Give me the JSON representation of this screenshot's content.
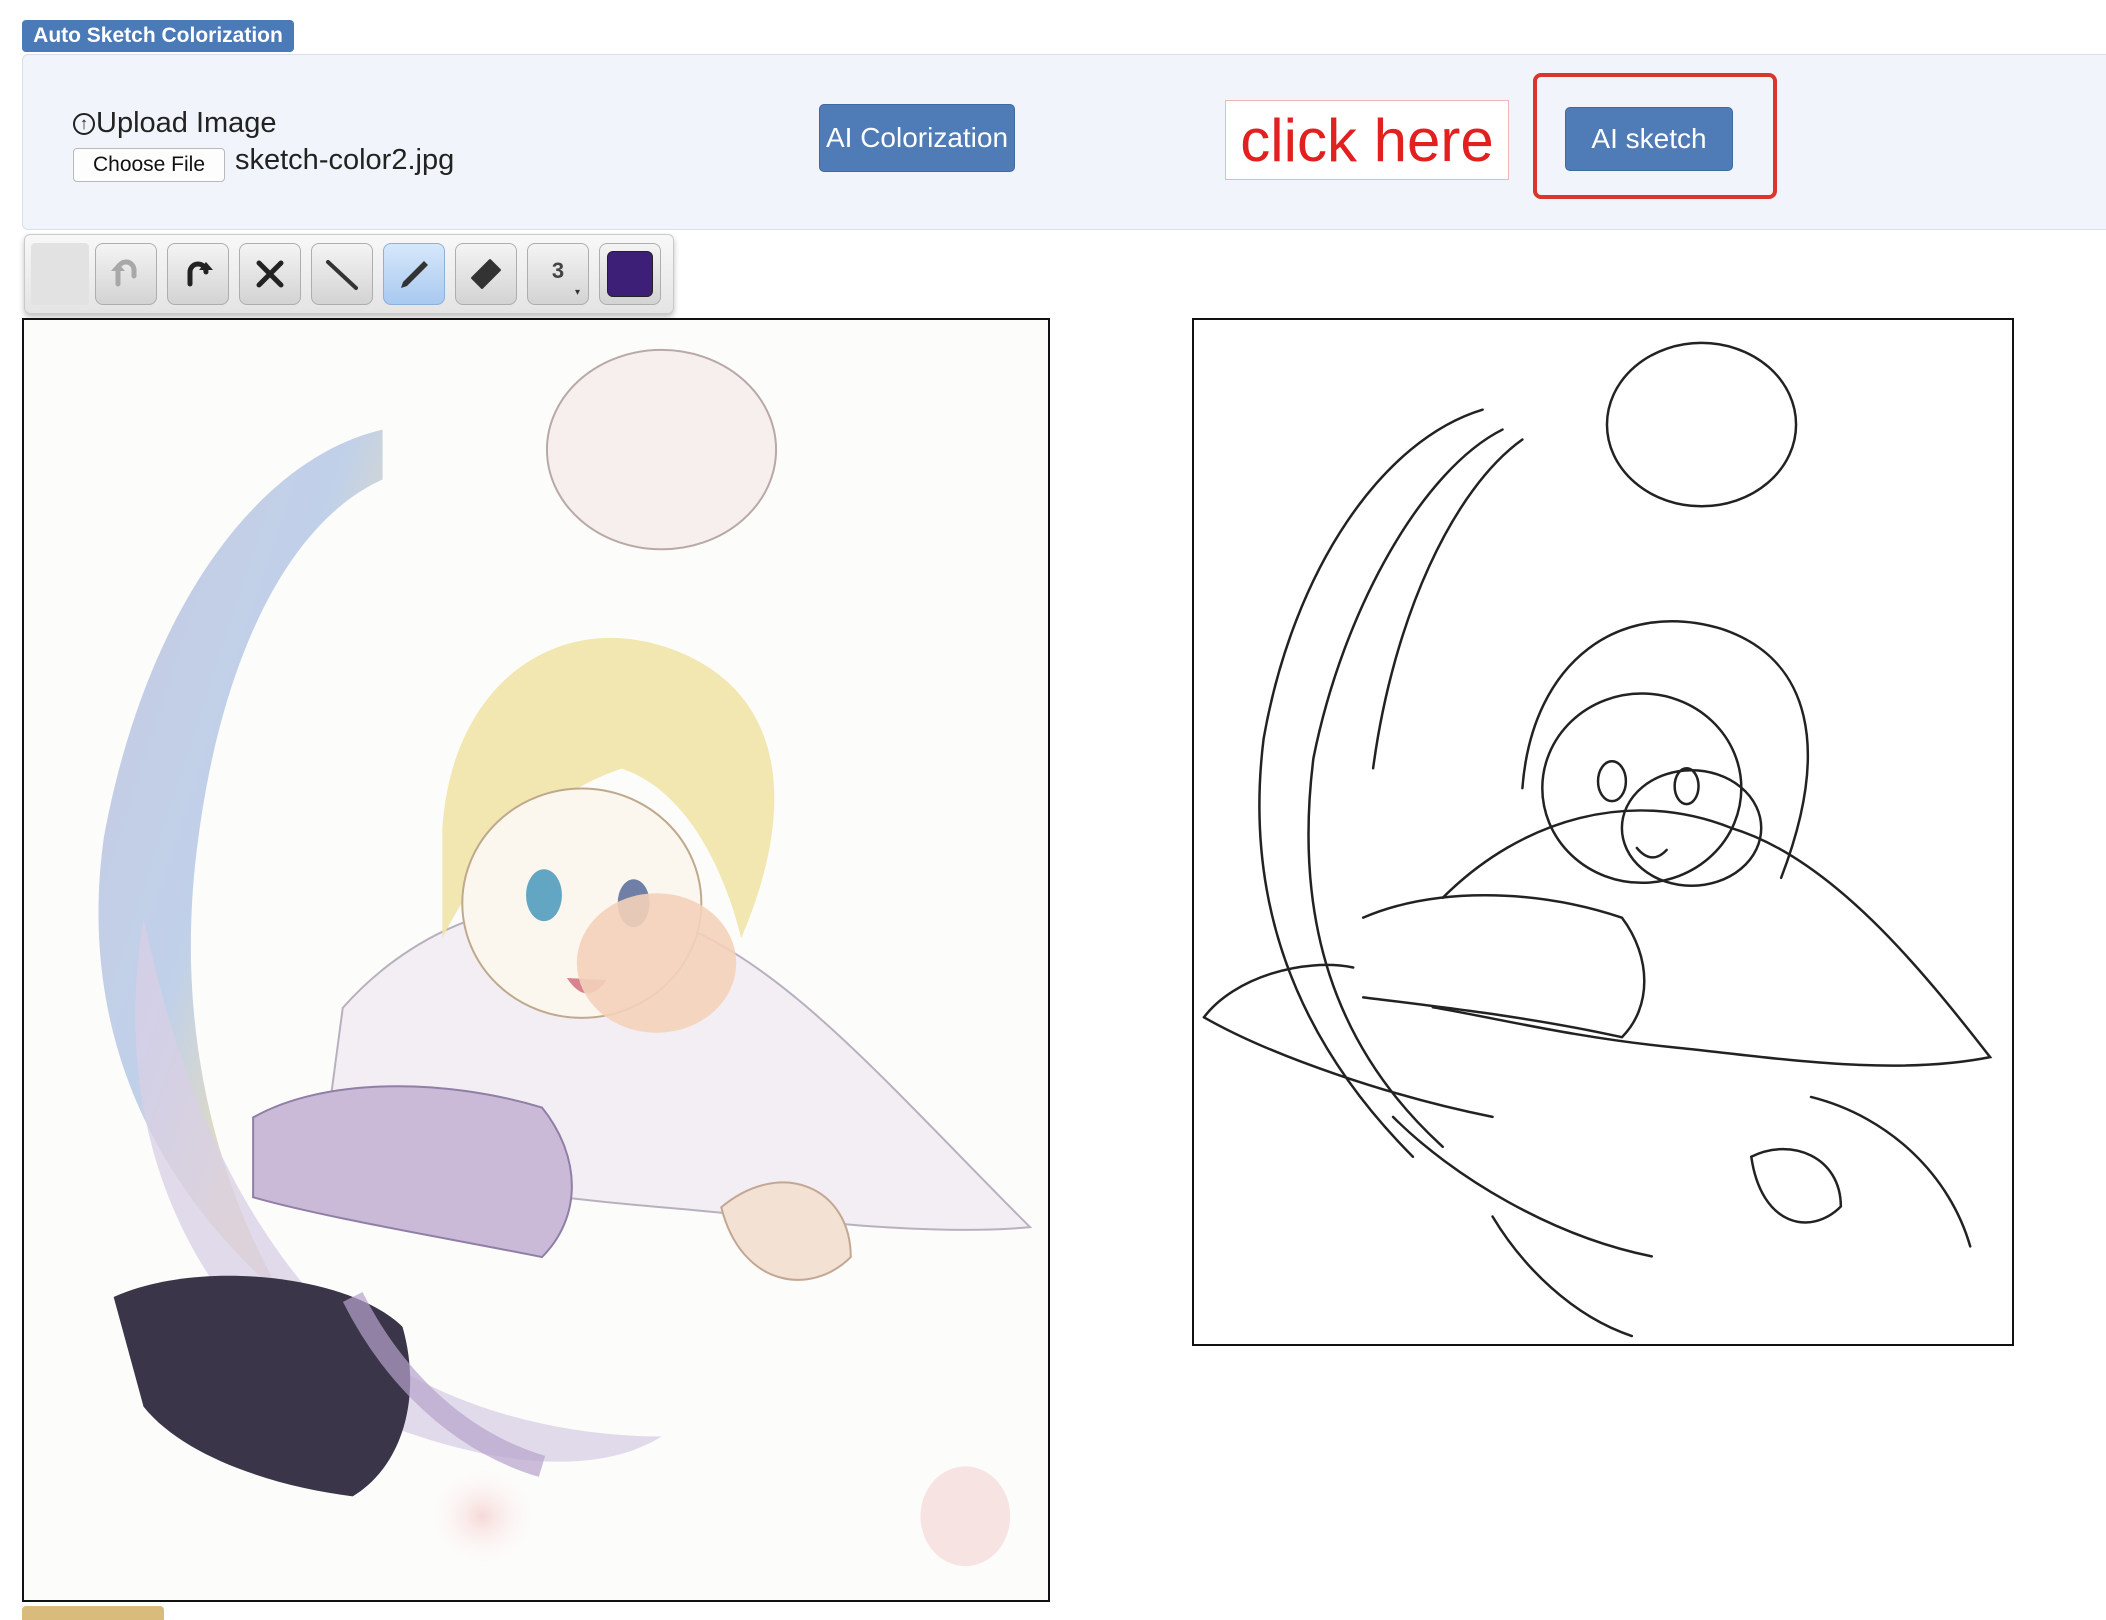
{
  "app": {
    "title": "Auto Sketch Colorization"
  },
  "upload": {
    "label": "Upload Image",
    "choose_file_label": "Choose File",
    "file_name": "sketch-color2.jpg"
  },
  "buttons": {
    "colorize_label": "AI Colorization",
    "sketch_label": "AI sketch"
  },
  "annotation": {
    "text": "click here",
    "color": "#e22020"
  },
  "toolbar": {
    "tools": [
      "undo-icon",
      "redo-icon",
      "clear-icon",
      "line-icon",
      "pencil-icon",
      "eraser-icon"
    ],
    "active_tool": "pencil-icon",
    "brush_size": "3",
    "current_color": "#3d1f78"
  },
  "colors": {
    "primary_button": "#4f7cb6",
    "highlight": "#d9372c",
    "title_badge": "#4a7ab7"
  }
}
